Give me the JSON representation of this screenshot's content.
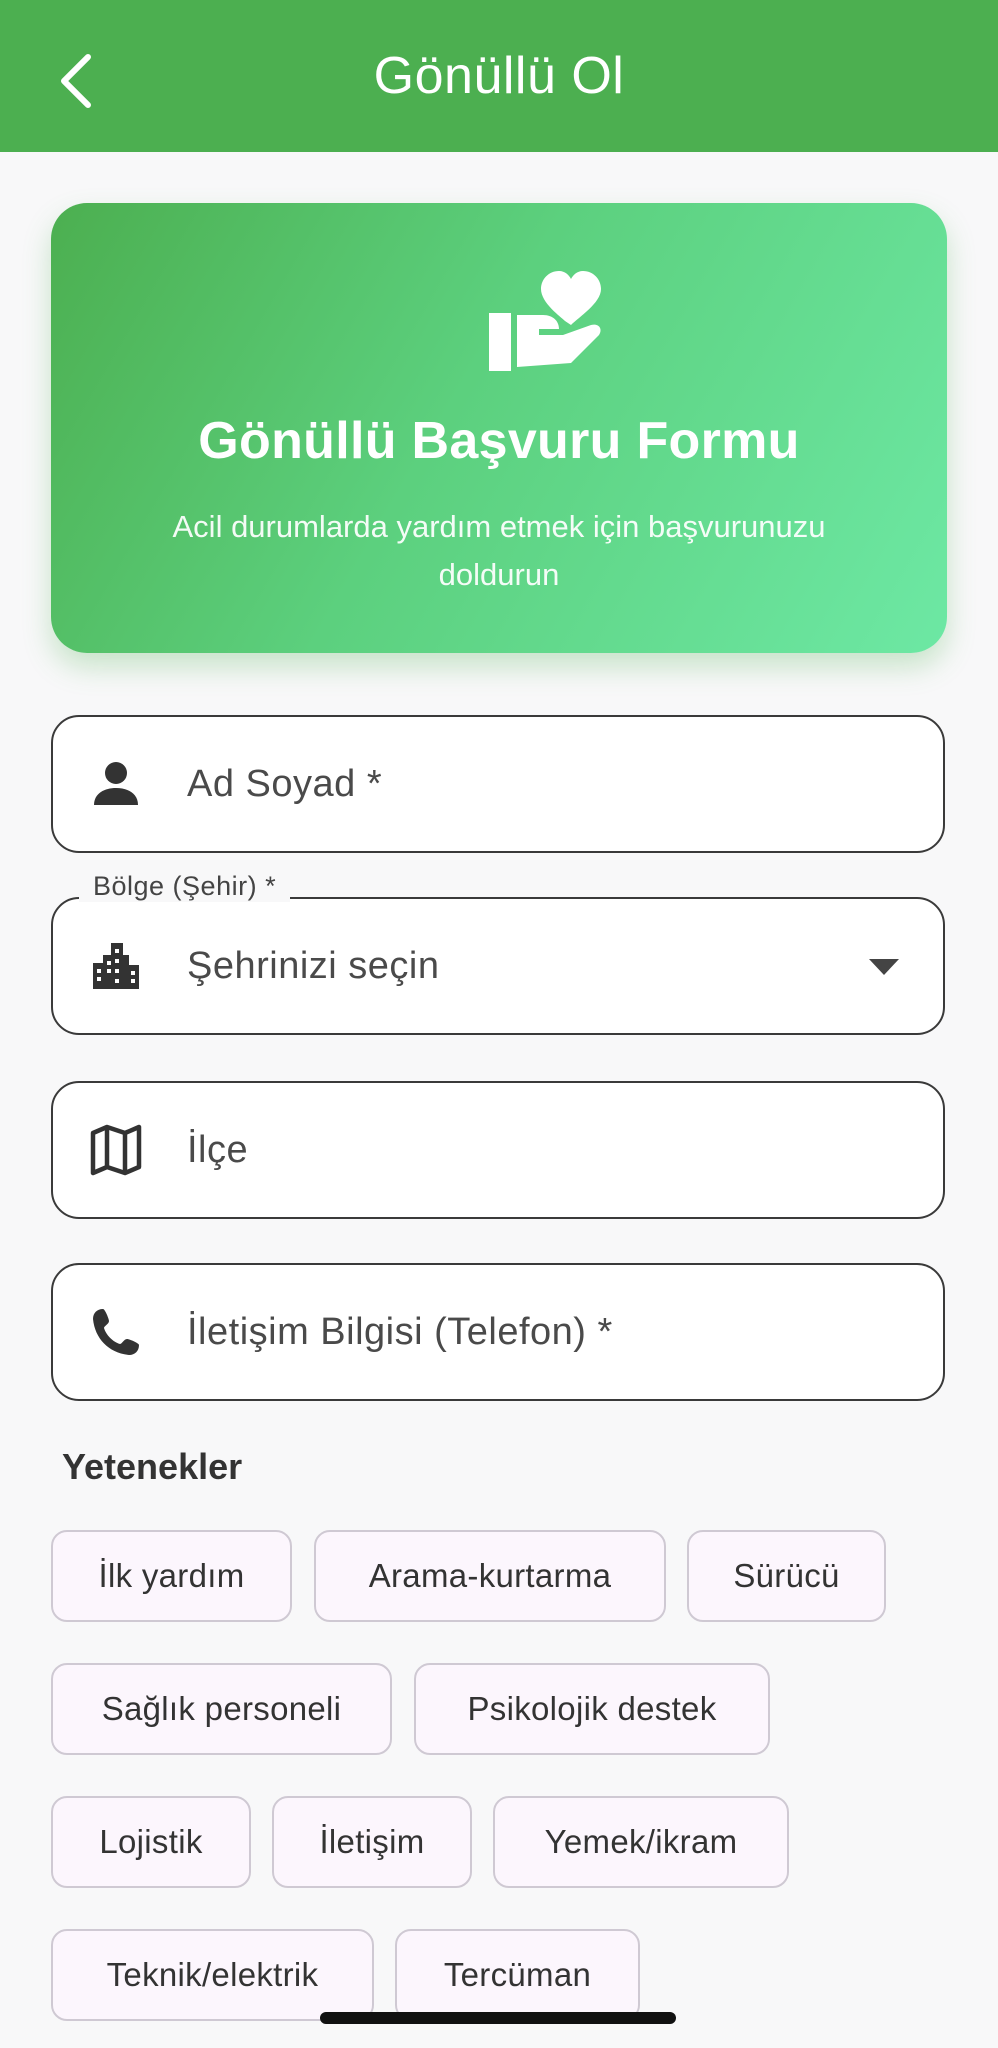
{
  "appbar": {
    "title": "Gönüllü Ol"
  },
  "hero": {
    "icon": "volunteer-heart-hand-icon",
    "title": "Gönüllü Başvuru Formu",
    "subtitle": "Acil durumlarda yardım etmek için başvurunuzu doldurun"
  },
  "form": {
    "name_placeholder": "Ad Soyad *",
    "city_label": "Bölge (Şehir) *",
    "city_placeholder": "Şehrinizi seçin",
    "district_placeholder": "İlçe",
    "phone_placeholder": "İletişim Bilgisi (Telefon) *"
  },
  "skills": {
    "title": "Yetenekler",
    "chips": [
      "İlk yardım",
      "Arama-kurtarma",
      "Sürücü",
      "Sağlık personeli",
      "Psikolojik destek",
      "Lojistik",
      "İletişim",
      "Yemek/ikram",
      "Teknik/elektrik",
      "Tercüman"
    ]
  },
  "colors": {
    "primary": "#4caf50",
    "gradient_end": "#6de8a4",
    "chip_bg": "#fcf6fd"
  }
}
